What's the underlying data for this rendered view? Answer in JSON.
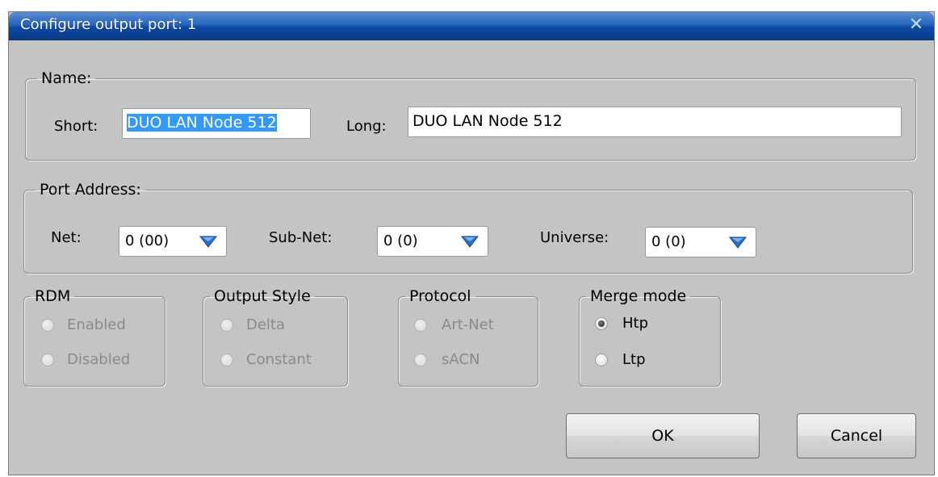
{
  "window": {
    "title": "Configure output port: 1"
  },
  "name_group": {
    "legend": "Name:",
    "short_label": "Short:",
    "short_value": "DUO LAN Node 512",
    "long_label": "Long:",
    "long_value": "DUO LAN Node 512"
  },
  "port_address": {
    "legend": "Port Address:",
    "net_label": "Net:",
    "net_value": "0 (00)",
    "subnet_label": "Sub-Net:",
    "subnet_value": "0 (0)",
    "universe_label": "Universe:",
    "universe_value": "0 (0)"
  },
  "rdm": {
    "legend": "RDM",
    "options": [
      "Enabled",
      "Disabled"
    ],
    "enabled": false
  },
  "output_style": {
    "legend": "Output Style",
    "options": [
      "Delta",
      "Constant"
    ],
    "enabled": false
  },
  "protocol": {
    "legend": "Protocol",
    "options": [
      "Art-Net",
      "sACN"
    ],
    "enabled": false
  },
  "merge_mode": {
    "legend": "Merge mode",
    "options": [
      "Htp",
      "Ltp"
    ],
    "selected": "Htp",
    "enabled": true
  },
  "buttons": {
    "ok": "OK",
    "cancel": "Cancel"
  },
  "colors": {
    "title_bar": "#0d4aa6",
    "dialog_bg": "#c4c4c4",
    "selection": "#3399ff",
    "arrow": "#2a6fc9"
  },
  "icons": {
    "close": "close-icon",
    "dropdown": "dropdown-arrow-icon"
  }
}
